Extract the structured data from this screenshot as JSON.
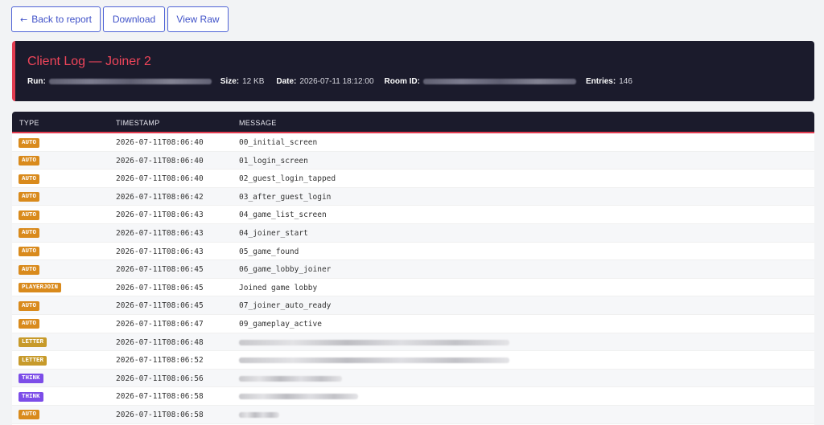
{
  "toolbar": {
    "back_label": "Back to report",
    "back_icon": "arrow-left-icon",
    "download_label": "Download",
    "raw_label": "View Raw"
  },
  "header": {
    "title": "Client Log — Joiner 2",
    "run_label": "Run:",
    "size_label": "Size:",
    "size_value": "12 KB",
    "date_label": "Date:",
    "date_value": "2026-07-11 18:12:00",
    "room_label": "Room ID:",
    "entries_label": "Entries:",
    "entries_value": "146"
  },
  "colors": {
    "accent": "#e23c50",
    "header_bg": "#1b1b2c",
    "auto": "#d98a1c",
    "playerjoin": "#d98a1c",
    "letter": "#c79a2a",
    "think": "#7c4de8",
    "button": "#3f51c8"
  },
  "table": {
    "columns": [
      "TYPE",
      "TIMESTAMP",
      "MESSAGE"
    ],
    "rows": [
      {
        "type": "AUTO",
        "timestamp": "2026-07-11T08:06:40",
        "message": "00_initial_screen"
      },
      {
        "type": "AUTO",
        "timestamp": "2026-07-11T08:06:40",
        "message": "01_login_screen"
      },
      {
        "type": "AUTO",
        "timestamp": "2026-07-11T08:06:40",
        "message": "02_guest_login_tapped"
      },
      {
        "type": "AUTO",
        "timestamp": "2026-07-11T08:06:42",
        "message": "03_after_guest_login"
      },
      {
        "type": "AUTO",
        "timestamp": "2026-07-11T08:06:43",
        "message": "04_game_list_screen"
      },
      {
        "type": "AUTO",
        "timestamp": "2026-07-11T08:06:43",
        "message": "04_joiner_start"
      },
      {
        "type": "AUTO",
        "timestamp": "2026-07-11T08:06:43",
        "message": "05_game_found"
      },
      {
        "type": "AUTO",
        "timestamp": "2026-07-11T08:06:45",
        "message": "06_game_lobby_joiner"
      },
      {
        "type": "PLAYERJOIN",
        "timestamp": "2026-07-11T08:06:45",
        "message": "Joined game lobby"
      },
      {
        "type": "AUTO",
        "timestamp": "2026-07-11T08:06:45",
        "message": "07_joiner_auto_ready"
      },
      {
        "type": "AUTO",
        "timestamp": "2026-07-11T08:06:47",
        "message": "09_gameplay_active"
      },
      {
        "type": "LETTER",
        "timestamp": "2026-07-11T08:06:48",
        "message": ""
      },
      {
        "type": "LETTER",
        "timestamp": "2026-07-11T08:06:52",
        "message": ""
      },
      {
        "type": "THINK",
        "timestamp": "2026-07-11T08:06:56",
        "message": ""
      },
      {
        "type": "THINK",
        "timestamp": "2026-07-11T08:06:58",
        "message": ""
      },
      {
        "type": "AUTO",
        "timestamp": "2026-07-11T08:06:58",
        "message": ""
      }
    ]
  }
}
